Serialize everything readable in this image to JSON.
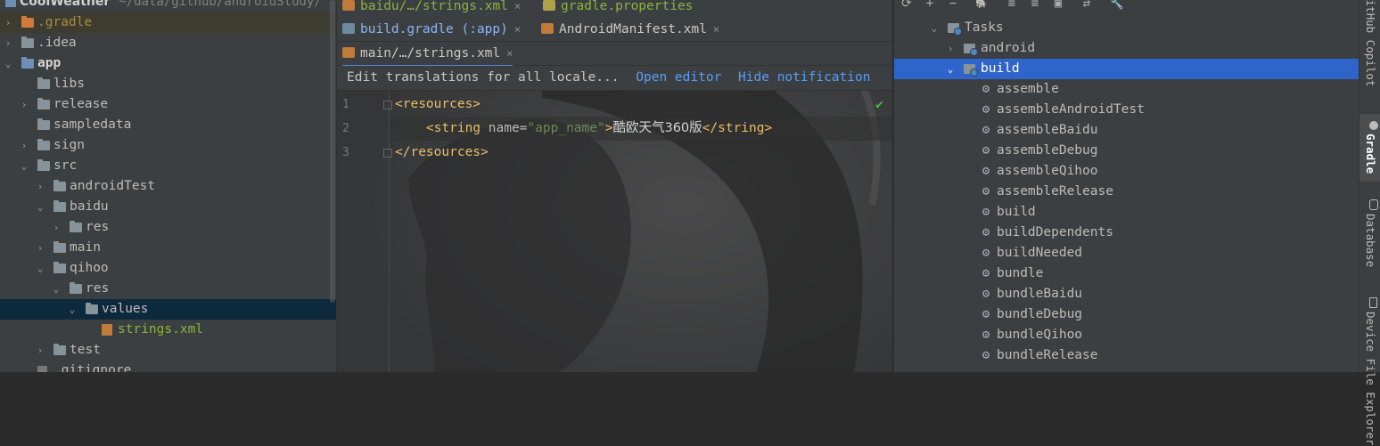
{
  "project_panel": {
    "title": "CoolWeather",
    "path": "~/data/github/androidStudy/",
    "items": [
      {
        "label": ".gradle",
        "arrow": "›"
      },
      {
        "label": ".idea",
        "arrow": "›"
      },
      {
        "label": "app",
        "arrow": "⌄"
      },
      {
        "label": "libs",
        "arrow": ""
      },
      {
        "label": "release",
        "arrow": "›"
      },
      {
        "label": "sampledata",
        "arrow": ""
      },
      {
        "label": "sign",
        "arrow": "›"
      },
      {
        "label": "src",
        "arrow": "⌄"
      },
      {
        "label": "androidTest",
        "arrow": "›"
      },
      {
        "label": "baidu",
        "arrow": "⌄"
      },
      {
        "label": "res",
        "arrow": "›"
      },
      {
        "label": "main",
        "arrow": "›"
      },
      {
        "label": "qihoo",
        "arrow": "⌄"
      },
      {
        "label": "res",
        "arrow": "⌄"
      },
      {
        "label": "values",
        "arrow": "⌄"
      },
      {
        "label": "strings.xml",
        "arrow": ""
      },
      {
        "label": "test",
        "arrow": "›"
      },
      {
        "label": ".gitignore",
        "arrow": ""
      }
    ]
  },
  "editor": {
    "tabs_row1": [
      {
        "label": "baidu/…/strings.xml"
      },
      {
        "label": "gradle.properties"
      }
    ],
    "tabs_row2": [
      {
        "label": "build.gradle (:app)"
      },
      {
        "label": "AndroidManifest.xml"
      }
    ],
    "tabs_row3": [
      {
        "label": "main/…/strings.xml"
      }
    ],
    "close_glyph": "×",
    "notification": {
      "message": "Edit translations for all locale...",
      "open_editor": "Open editor",
      "hide": "Hide notification"
    },
    "line_numbers": [
      "1",
      "2",
      "3"
    ],
    "code": {
      "l1_open": "<resources>",
      "l2_indent": "    ",
      "l2_tag_open": "<string",
      "l2_attr": " name=",
      "l2_val": "\"app_name\"",
      "l2_gt": ">",
      "l2_text": "酷欧天气360版",
      "l2_close": "</string>",
      "l2_end": ">",
      "l3_close": "</resources>"
    },
    "check": "✔"
  },
  "gradle_panel": {
    "toolbar": [
      "⟳",
      "+",
      "−",
      "🐘",
      "≡",
      "≡",
      "▣",
      "⇄",
      "🔧"
    ],
    "root": {
      "label": "Tasks",
      "arrow": "⌄"
    },
    "groups": [
      {
        "label": "android",
        "arrow": "›"
      },
      {
        "label": "build",
        "arrow": "⌄"
      }
    ],
    "tasks": [
      "assemble",
      "assembleAndroidTest",
      "assembleBaidu",
      "assembleDebug",
      "assembleQihoo",
      "assembleRelease",
      "build",
      "buildDependents",
      "buildNeeded",
      "bundle",
      "bundleBaidu",
      "bundleDebug",
      "bundleQihoo",
      "bundleRelease"
    ],
    "gear": "⚙"
  },
  "tool_strip": {
    "copilot": "GitHub Copilot",
    "gradle": "Gradle",
    "database": "Database",
    "device": "Device File Explorer"
  },
  "colors": {
    "accent": "#2f65ca",
    "selection_dark": "#0d293e",
    "link": "#589df6",
    "xml_tag": "#e8bf6a",
    "xml_value": "#6a8759"
  }
}
